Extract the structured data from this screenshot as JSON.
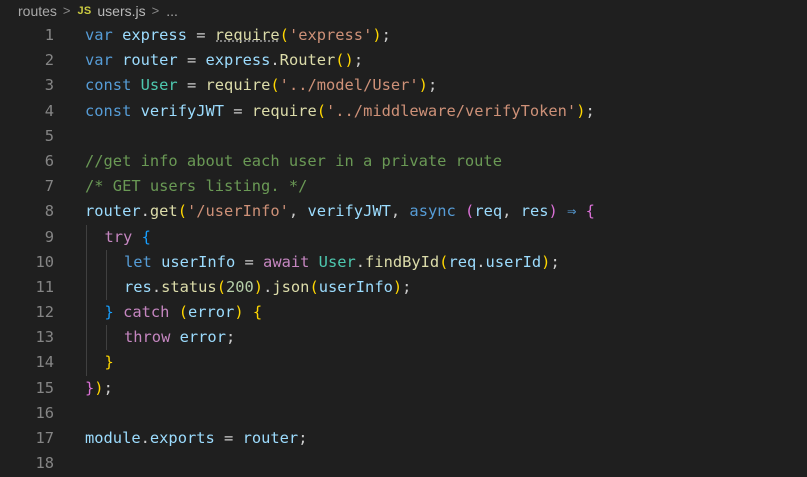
{
  "breadcrumb": {
    "folder": "routes",
    "separator": ">",
    "file_icon": "JS",
    "file": "users.js",
    "more": "..."
  },
  "theme": {
    "background": "#1f1f1f",
    "keyword": "#569cd6",
    "control": "#c586c0",
    "variable": "#9cdcfe",
    "class": "#4ec9b0",
    "function": "#dcdcaa",
    "string": "#ce9178",
    "number": "#b5cea8",
    "comment": "#6a9955",
    "line_number": "#858585"
  },
  "code": {
    "lines": [
      {
        "n": "1",
        "tokens": [
          [
            "kw",
            "var"
          ],
          [
            "pun",
            " "
          ],
          [
            "var",
            "express"
          ],
          [
            "pun",
            " = "
          ],
          [
            "fn",
            "require",
            "dotted"
          ],
          [
            "brk1",
            "("
          ],
          [
            "str",
            "'express'"
          ],
          [
            "brk1",
            ")"
          ],
          [
            "pun",
            ";"
          ]
        ]
      },
      {
        "n": "2",
        "tokens": [
          [
            "kw",
            "var"
          ],
          [
            "pun",
            " "
          ],
          [
            "var",
            "router"
          ],
          [
            "pun",
            " = "
          ],
          [
            "var",
            "express"
          ],
          [
            "pun",
            "."
          ],
          [
            "fn",
            "Router"
          ],
          [
            "brk1",
            "()"
          ],
          [
            "pun",
            ";"
          ]
        ]
      },
      {
        "n": "3",
        "tokens": [
          [
            "kw",
            "const"
          ],
          [
            "pun",
            " "
          ],
          [
            "cls",
            "User"
          ],
          [
            "pun",
            " = "
          ],
          [
            "fn",
            "require"
          ],
          [
            "brk1",
            "("
          ],
          [
            "str",
            "'../model/User'"
          ],
          [
            "brk1",
            ")"
          ],
          [
            "pun",
            ";"
          ]
        ]
      },
      {
        "n": "4",
        "tokens": [
          [
            "kw",
            "const"
          ],
          [
            "pun",
            " "
          ],
          [
            "var",
            "verifyJWT"
          ],
          [
            "pun",
            " = "
          ],
          [
            "fn",
            "require"
          ],
          [
            "brk1",
            "("
          ],
          [
            "str",
            "'../middleware/verifyToken'"
          ],
          [
            "brk1",
            ")"
          ],
          [
            "pun",
            ";"
          ]
        ]
      },
      {
        "n": "5",
        "tokens": []
      },
      {
        "n": "6",
        "tokens": [
          [
            "com",
            "//get info about each user in a private route"
          ]
        ]
      },
      {
        "n": "7",
        "tokens": [
          [
            "com",
            "/* GET users listing. */"
          ]
        ]
      },
      {
        "n": "8",
        "tokens": [
          [
            "var",
            "router"
          ],
          [
            "pun",
            "."
          ],
          [
            "fn",
            "get"
          ],
          [
            "brk1",
            "("
          ],
          [
            "str",
            "'/userInfo'"
          ],
          [
            "pun",
            ", "
          ],
          [
            "var",
            "verifyJWT"
          ],
          [
            "pun",
            ", "
          ],
          [
            "kw",
            "async"
          ],
          [
            "pun",
            " "
          ],
          [
            "brk2",
            "("
          ],
          [
            "var",
            "req"
          ],
          [
            "pun",
            ", "
          ],
          [
            "var",
            "res"
          ],
          [
            "brk2",
            ")"
          ],
          [
            "pun",
            " "
          ],
          [
            "arrow",
            "⇒"
          ],
          [
            "pun",
            " "
          ],
          [
            "brk2",
            "{"
          ]
        ]
      },
      {
        "n": "9",
        "indent": 1,
        "tokens": [
          [
            "ctl",
            "try"
          ],
          [
            "pun",
            " "
          ],
          [
            "brk3",
            "{"
          ]
        ]
      },
      {
        "n": "10",
        "indent": 2,
        "tokens": [
          [
            "kw",
            "let"
          ],
          [
            "pun",
            " "
          ],
          [
            "var",
            "userInfo"
          ],
          [
            "pun",
            " = "
          ],
          [
            "ctl",
            "await"
          ],
          [
            "pun",
            " "
          ],
          [
            "cls",
            "User"
          ],
          [
            "pun",
            "."
          ],
          [
            "fn",
            "findById"
          ],
          [
            "brk1",
            "("
          ],
          [
            "var",
            "req"
          ],
          [
            "pun",
            "."
          ],
          [
            "var",
            "userId"
          ],
          [
            "brk1",
            ")"
          ],
          [
            "pun",
            ";"
          ]
        ]
      },
      {
        "n": "11",
        "indent": 2,
        "tokens": [
          [
            "var",
            "res"
          ],
          [
            "pun",
            "."
          ],
          [
            "fn",
            "status"
          ],
          [
            "brk1",
            "("
          ],
          [
            "num",
            "200"
          ],
          [
            "brk1",
            ")"
          ],
          [
            "pun",
            "."
          ],
          [
            "fn",
            "json"
          ],
          [
            "brk1",
            "("
          ],
          [
            "var",
            "userInfo"
          ],
          [
            "brk1",
            ")"
          ],
          [
            "pun",
            ";"
          ]
        ]
      },
      {
        "n": "12",
        "indent": 1,
        "tokens": [
          [
            "brk3",
            "}"
          ],
          [
            "pun",
            " "
          ],
          [
            "ctl",
            "catch"
          ],
          [
            "pun",
            " "
          ],
          [
            "brk1",
            "("
          ],
          [
            "var",
            "error"
          ],
          [
            "brk1",
            ")"
          ],
          [
            "pun",
            " "
          ],
          [
            "brk1",
            "{"
          ]
        ]
      },
      {
        "n": "13",
        "indent": 2,
        "tokens": [
          [
            "ctl",
            "throw"
          ],
          [
            "pun",
            " "
          ],
          [
            "var",
            "error"
          ],
          [
            "pun",
            ";"
          ]
        ]
      },
      {
        "n": "14",
        "indent": 1,
        "tokens": [
          [
            "brk1",
            "}"
          ]
        ]
      },
      {
        "n": "15",
        "tokens": [
          [
            "brk2",
            "}"
          ],
          [
            "brk1",
            ")"
          ],
          [
            "pun",
            ";"
          ]
        ]
      },
      {
        "n": "16",
        "tokens": []
      },
      {
        "n": "17",
        "tokens": [
          [
            "var",
            "module"
          ],
          [
            "pun",
            "."
          ],
          [
            "var",
            "exports"
          ],
          [
            "pun",
            " = "
          ],
          [
            "var",
            "router"
          ],
          [
            "pun",
            ";"
          ]
        ]
      },
      {
        "n": "18",
        "tokens": []
      }
    ]
  }
}
